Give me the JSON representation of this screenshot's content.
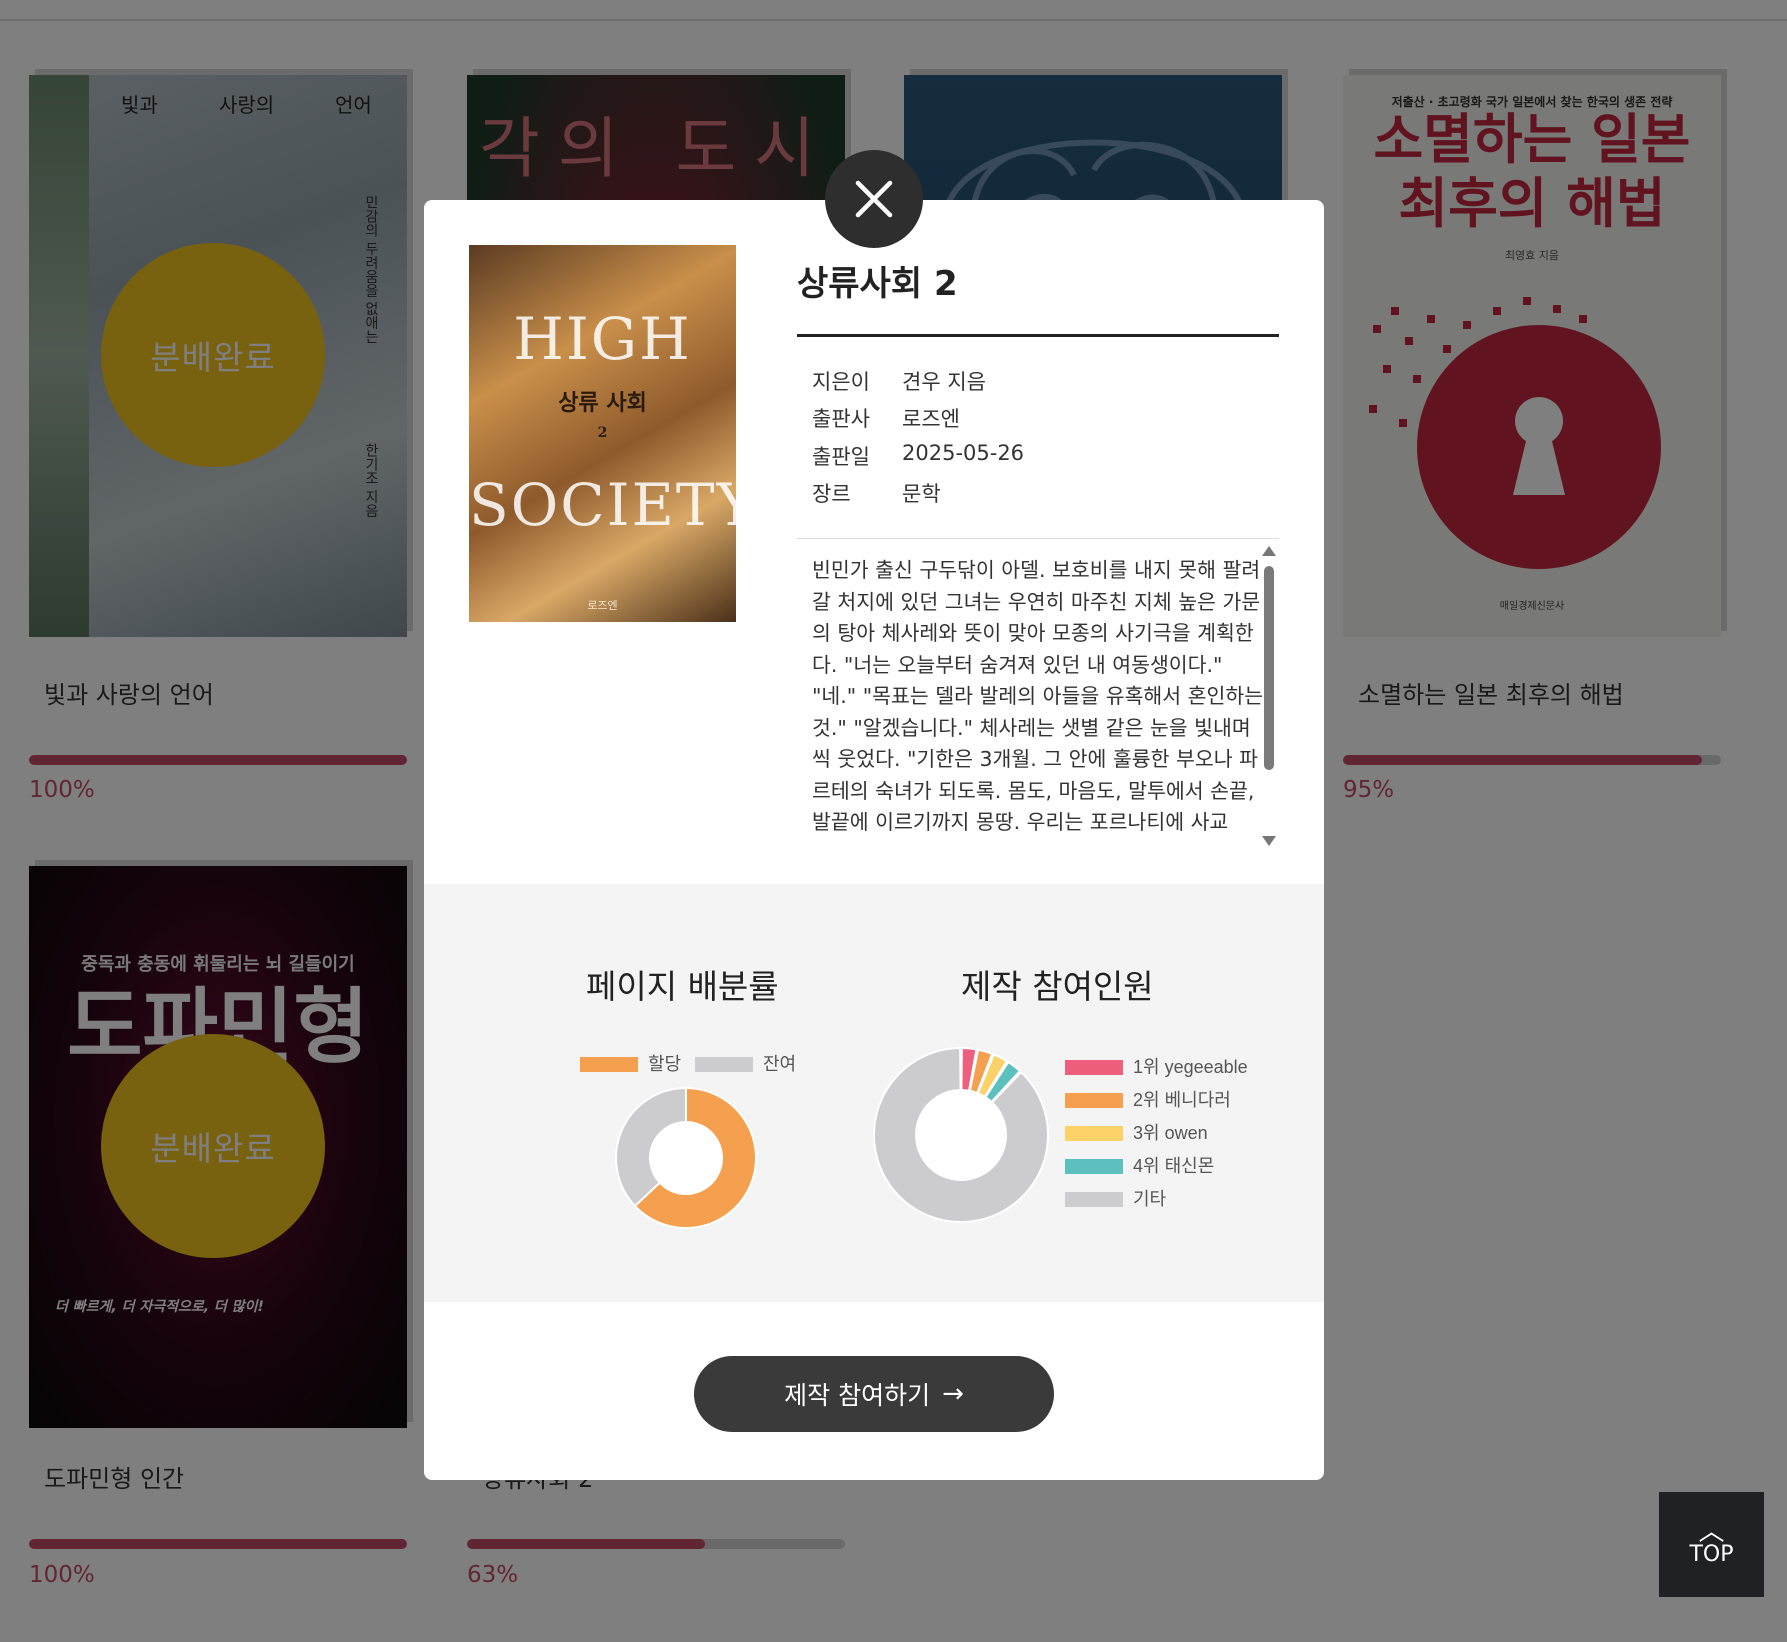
{
  "grid": {
    "books": [
      {
        "title": "빛과 사랑의 언어",
        "progress": 100,
        "progress_label": "100%",
        "badge": "분배완료",
        "cover_text": {
          "words": [
            "빛과",
            "사랑의",
            "언어"
          ],
          "vertical_1": "민감의 두려움을 없애는",
          "vertical_2": "한기조 지음"
        }
      },
      {
        "title": "",
        "progress": null,
        "progress_label": "",
        "badge": "",
        "cover_text": {
          "big": "각의 도시"
        }
      },
      {
        "title": "",
        "progress": null,
        "progress_label": "",
        "badge": ""
      },
      {
        "title": "소멸하는 일본 최후의 해법",
        "progress": 95,
        "progress_label": "95%",
        "badge": "",
        "cover_text": {
          "subtitle": "저출산 · 초고령화 국가 일본에서 찾는 한국의 생존 전략",
          "big1": "소멸하는 일본",
          "big2": "최후의 해법",
          "author": "최영효 지음",
          "publisher": "매일경제신문사"
        }
      },
      {
        "title": "도파민형 인간",
        "progress": 100,
        "progress_label": "100%",
        "badge": "분배완료",
        "cover_text": {
          "subtitle": "중독과 충동에 휘둘리는 뇌 길들이기",
          "big1": "도파민형",
          "big2": "인간",
          "tag": "더 빠르게, 더 자극적으로, 더 많이!"
        }
      },
      {
        "title": "상류사회 2",
        "progress": 63,
        "progress_label": "63%",
        "badge": ""
      }
    ]
  },
  "top_button": {
    "label": "TOP"
  },
  "modal": {
    "title": "상류사회 2",
    "cover": {
      "word1": "HIGH",
      "korean": "상류 사회",
      "number": "2",
      "word2": "SOCIETY",
      "publisher": "로즈엔"
    },
    "meta": [
      {
        "label": "지은이",
        "value": "견우 지음"
      },
      {
        "label": "출판사",
        "value": "로즈엔"
      },
      {
        "label": "출판일",
        "value": "2025-05-26"
      },
      {
        "label": "장르",
        "value": "문학"
      }
    ],
    "description": "빈민가 출신 구두닦이 아델. 보호비를 내지 못해 팔려 갈 처지에 있던 그녀는 우연히 마주친 지체 높은 가문의 탕아 체사레와 뜻이 맞아 모종의 사기극을 계획한다. \"너는 오늘부터 숨겨져 있던 내 여동생이다.\" \"네.\" \"목표는 델라 발레의 아들을 유혹해서 혼인하는 것.\" \"알겠습니다.\" 체사레는 샛별 같은 눈을 빛내며 씩 웃었다. \"기한은 3개월. 그 안에 훌륭한 부오나 파르테의 숙녀가 되도록. 몸도, 마음도, 말투에서 손끝, 발끝에 이르기까지 몽땅. 우리는 포르나티에 사교",
    "cta_label": "제작 참여하기",
    "cta_arrow": "→"
  },
  "chart_data": [
    {
      "type": "pie",
      "title": "페이지 배분률",
      "categories": [
        "할당",
        "잔여"
      ],
      "values": [
        63,
        37
      ],
      "colors": [
        "#f5a04e",
        "#cccccf"
      ],
      "legend_position": "top"
    },
    {
      "type": "pie",
      "title": "제작 참여인원",
      "categories": [
        "1위 yegeeable",
        "2위 베니다러",
        "3위 owen",
        "4위 태신몬",
        "기타"
      ],
      "values": [
        3,
        3,
        3,
        3,
        88
      ],
      "colors": [
        "#ee5f7d",
        "#f5a04e",
        "#fbd168",
        "#5cc0bf",
        "#cccccf"
      ],
      "legend_position": "right"
    }
  ]
}
